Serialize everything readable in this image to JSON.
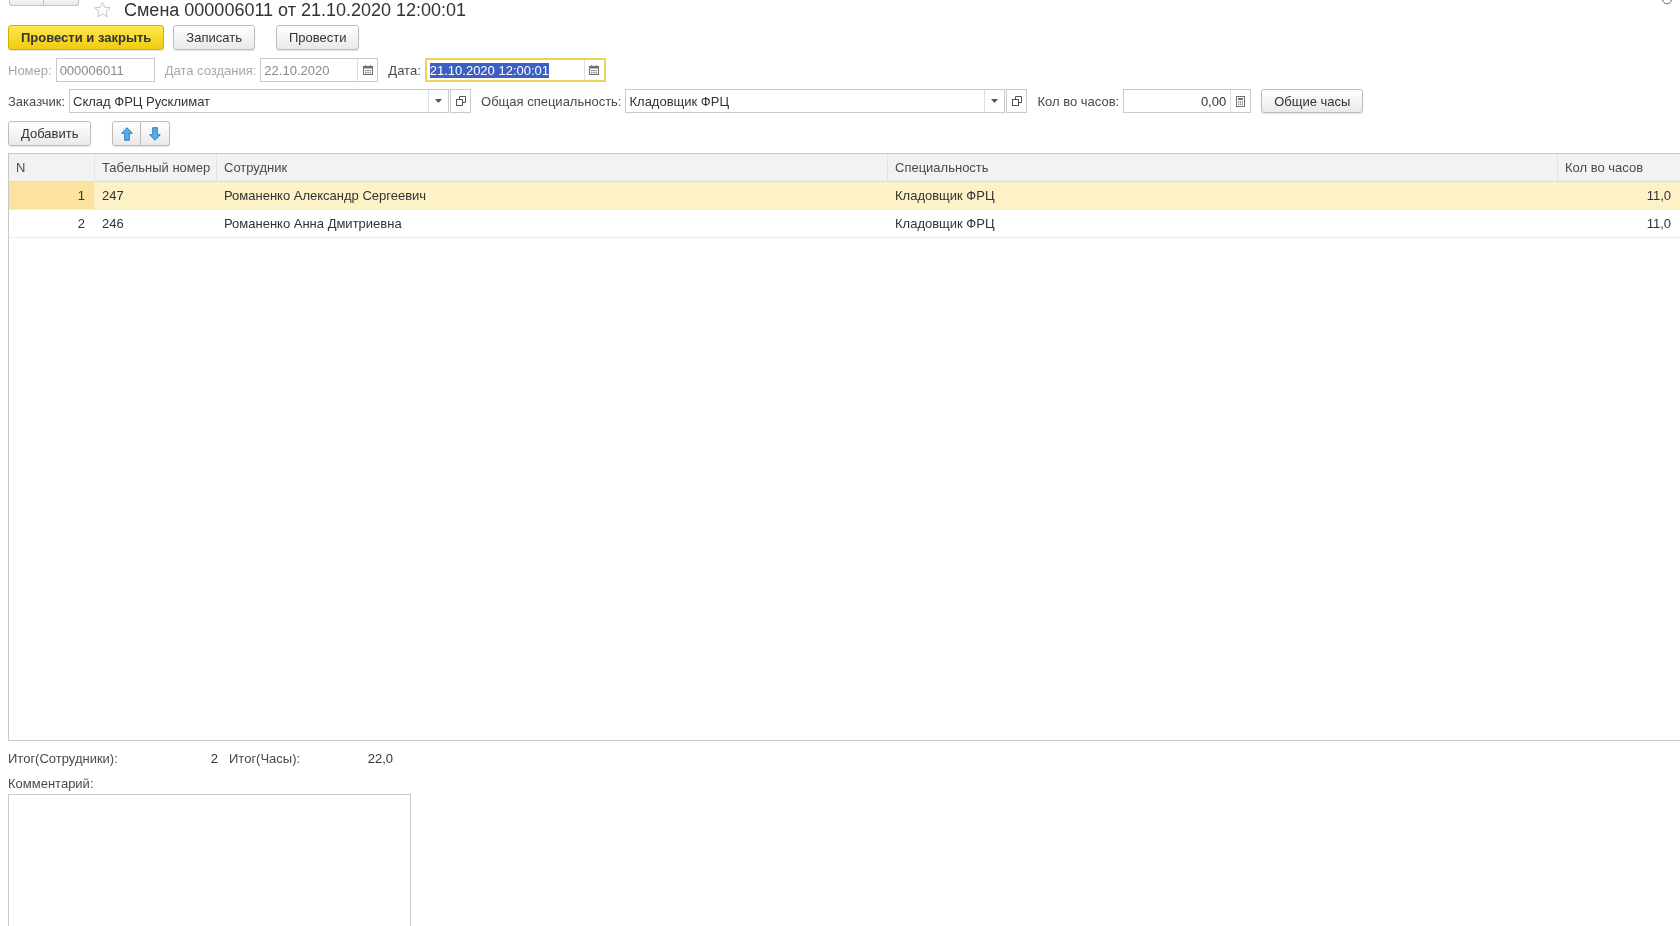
{
  "header": {
    "title": "Смена 000006011 от 21.10.2020 12:00:01"
  },
  "toolbar": {
    "buttons": [
      {
        "label": "Провести и закрыть",
        "kind": "primary"
      },
      {
        "label": "Записать",
        "kind": "default"
      },
      {
        "label": "Провести",
        "kind": "default"
      }
    ]
  },
  "fields": [
    {
      "label": "Номер:",
      "value": "000006011",
      "kind": "text",
      "disabled": true,
      "focused": false,
      "text_selected": false
    },
    {
      "label": "Дата создания:",
      "value": "22.10.2020",
      "kind": "date",
      "disabled": true,
      "focused": false,
      "text_selected": false
    },
    {
      "label": "Дата:",
      "value": "21.10.2020 12:00:01",
      "kind": "date",
      "disabled": false,
      "focused": true,
      "text_selected": true
    }
  ],
  "params": [
    {
      "label": "Заказчик:",
      "value": "Склад ФРЦ Русклимат",
      "kind": "select"
    },
    {
      "label": "Общая специальность:",
      "value": "Кладовщик ФРЦ",
      "kind": "select"
    },
    {
      "label": "Кол во часов:",
      "value": "0,00",
      "kind": "number"
    }
  ],
  "hours_button": "Общие часы",
  "table_toolbar": {
    "add_button": "Добавить"
  },
  "table": {
    "columns": [
      {
        "label": "N",
        "kind": "number"
      },
      {
        "label": "Табельный номер",
        "kind": "text"
      },
      {
        "label": "Сотрудник",
        "kind": "text"
      },
      {
        "label": "Специальность",
        "kind": "text"
      },
      {
        "label": "Кол во часов",
        "kind": "number"
      }
    ],
    "rows": [
      {
        "cells": [
          "1",
          "247",
          "Романенко Александр Сергеевич",
          "Кладовщик ФРЦ",
          "11,0"
        ],
        "selected": true
      },
      {
        "cells": [
          "2",
          "246",
          "Романенко Анна Дмитриевна",
          "Кладовщик ФРЦ",
          "11,0"
        ],
        "selected": false
      }
    ]
  },
  "totals": [
    {
      "label": "Итог(Сотрудники):",
      "value": "2"
    },
    {
      "label": "Итог(Часы):",
      "value": "22,0"
    }
  ],
  "comment": {
    "label": "Комментарий:"
  }
}
